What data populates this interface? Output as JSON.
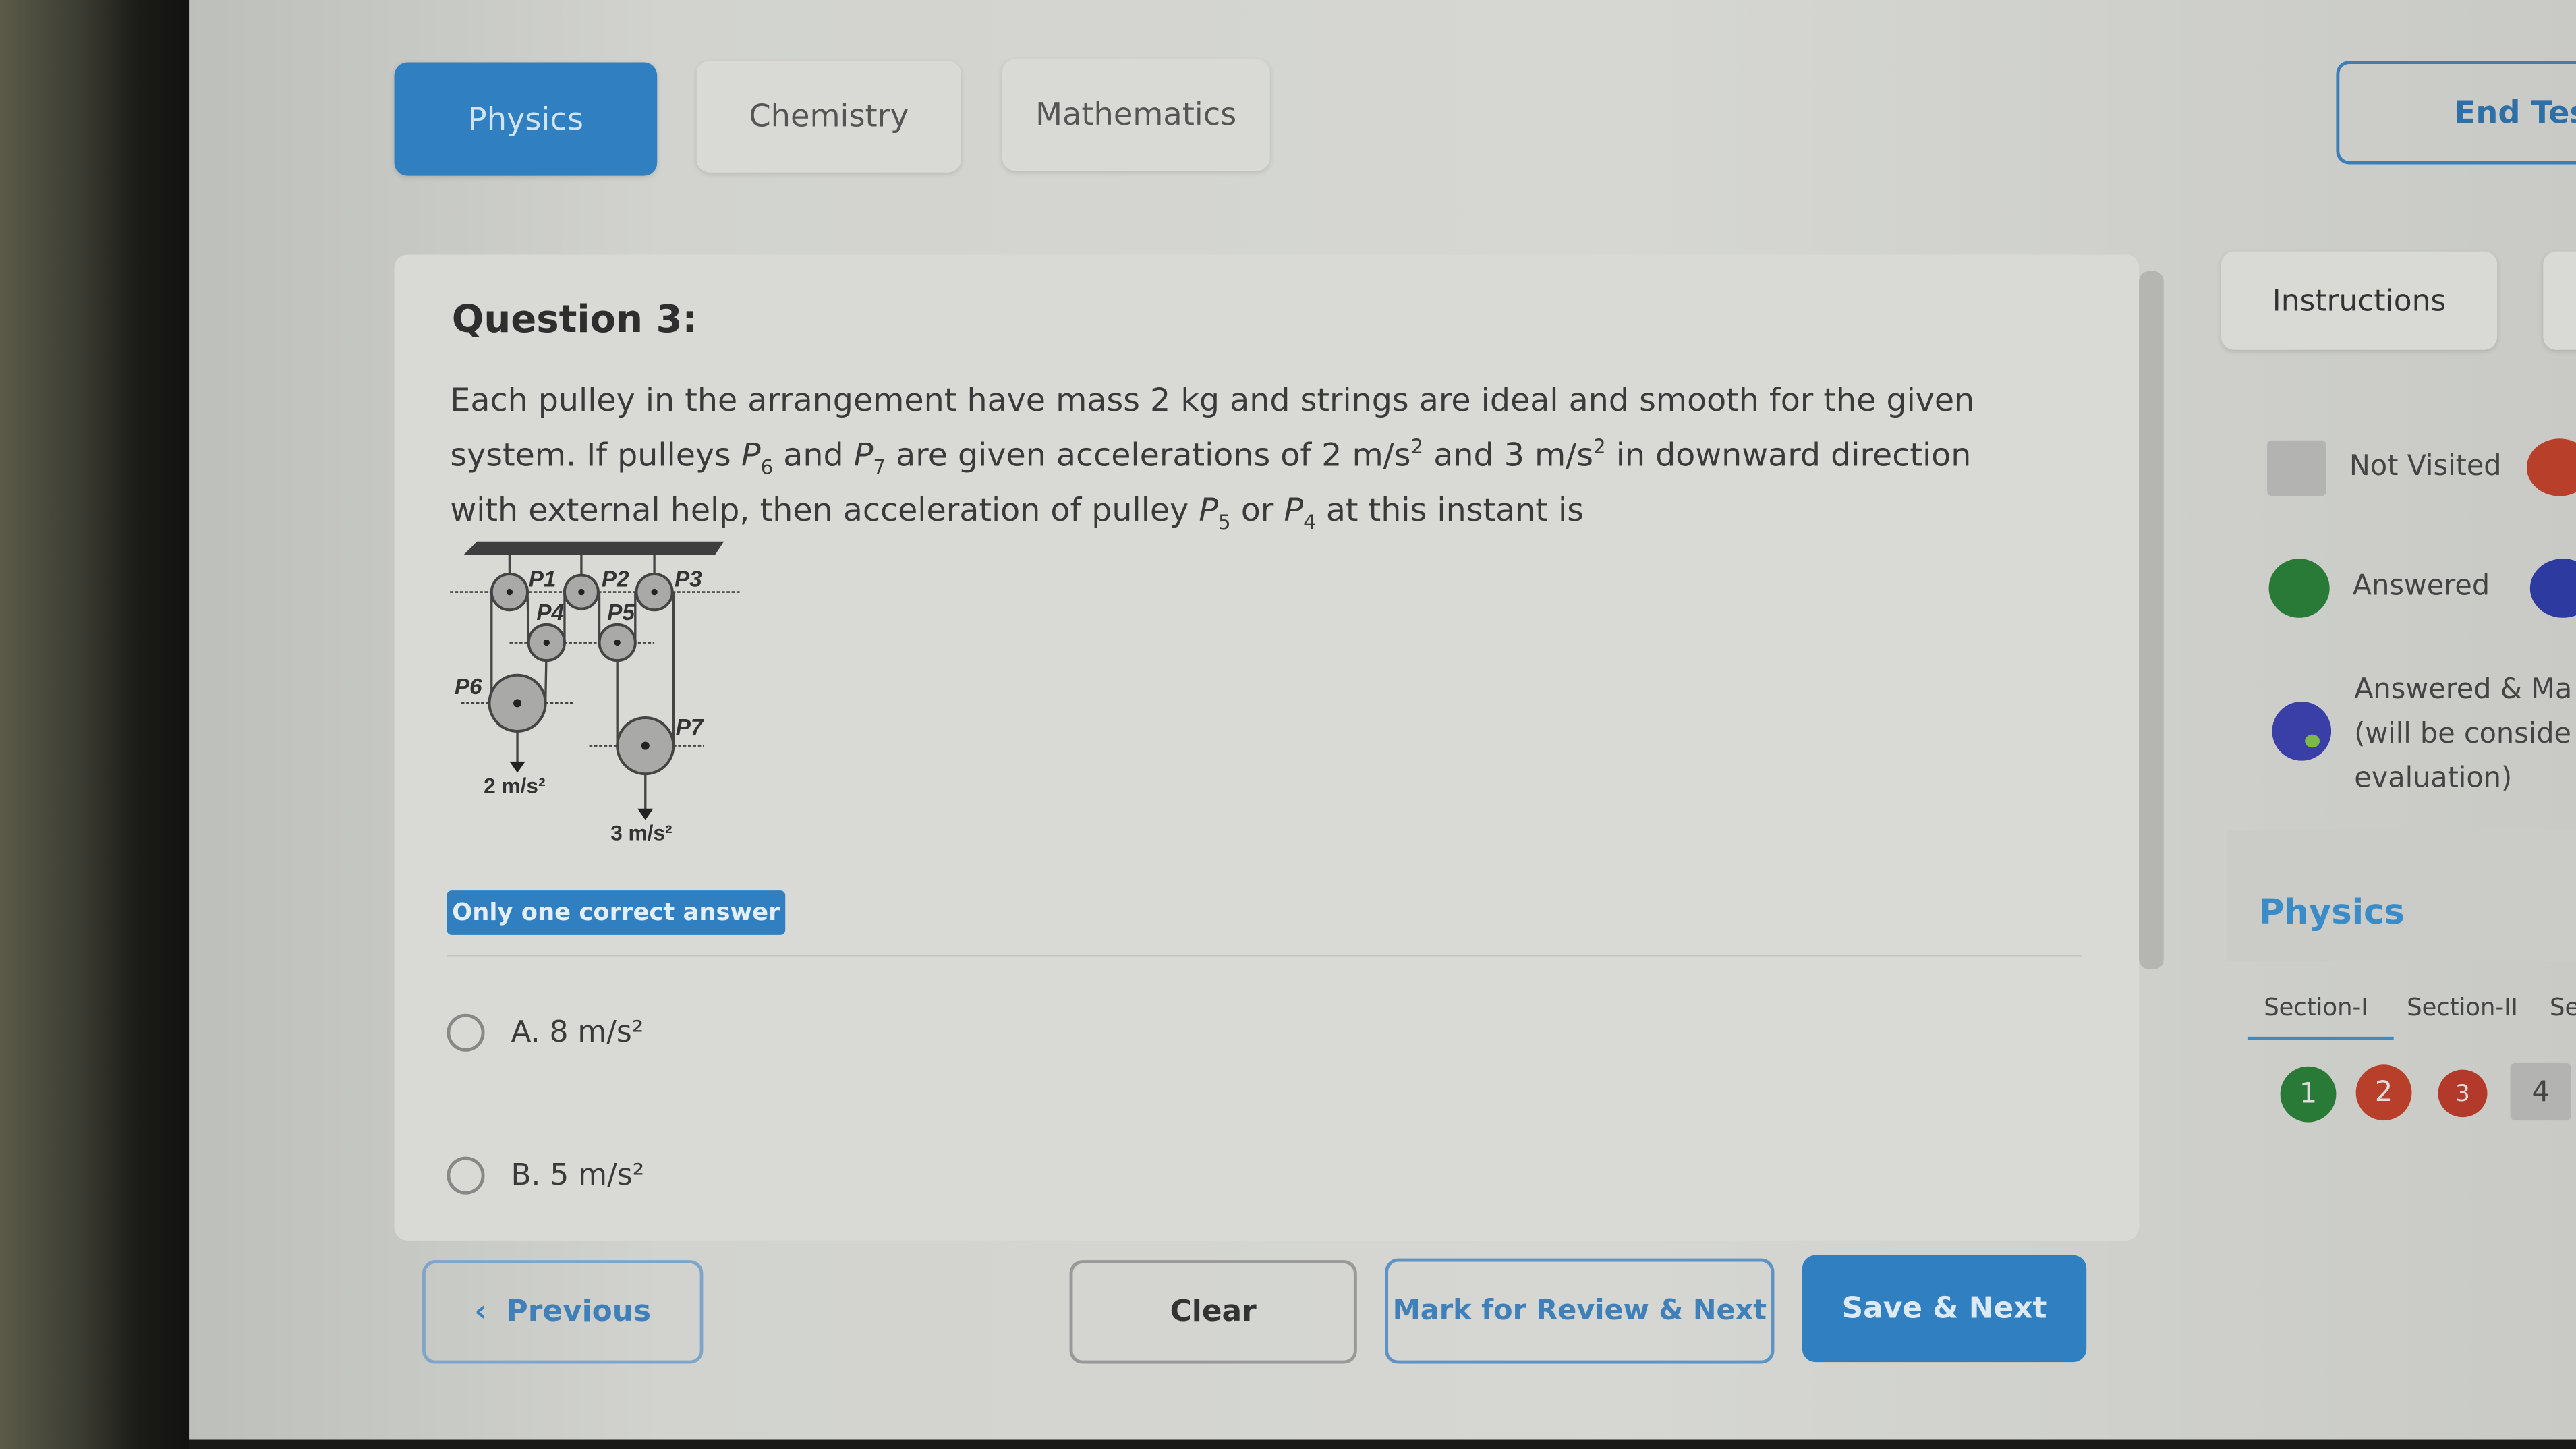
{
  "tabs": [
    {
      "label": "Physics",
      "active": true
    },
    {
      "label": "Chemistry"
    },
    {
      "label": "Mathematics"
    }
  ],
  "end_test_label": "End Tes",
  "question": {
    "title": "Question 3:",
    "lines": [
      "Each pulley in the arrangement have mass 2 kg and strings are ideal and smooth for the given",
      "system. If pulleys P6 and P7 are given accelerations of 2 m/s2 and 3 m/s2 in downward direction",
      "with external help, then acceleration of pulley P5 or P4 at this instant is"
    ],
    "diagram_labels": [
      "P1",
      "P2",
      "P3",
      "P4",
      "P5",
      "P6",
      "P7",
      "2 m/s²",
      "3 m/s²"
    ],
    "badge": "Only one correct answer",
    "options": [
      {
        "label": "A. 8 m/s²",
        "selected": false
      },
      {
        "label": "B. 5 m/s²",
        "selected": false
      }
    ]
  },
  "buttons": {
    "previous": "Previous",
    "clear": "Clear",
    "mark": "Mark for Review & Next",
    "save": "Save & Next"
  },
  "sidebar": {
    "instructions": "Instructions",
    "legend": [
      {
        "label": "Not Visited",
        "color": "#b3b3b1"
      },
      {
        "label": "Answered",
        "color": "#2a7a37"
      },
      {
        "label_lines": [
          "Answered & Ma",
          "(will be conside",
          "evaluation)"
        ],
        "color": "#3a3fa8"
      }
    ],
    "subject": "Physics",
    "sections": [
      "Section-I",
      "Section-II",
      "Se"
    ],
    "questions": [
      {
        "n": "1",
        "status": "answered",
        "color": "#2a7a37"
      },
      {
        "n": "2",
        "status": "not-answered",
        "color": "#c0392b"
      },
      {
        "n": "3",
        "status": "not-answered",
        "color": "#c0392b"
      },
      {
        "n": "4",
        "status": "not-visited",
        "color": "#b3b3b1"
      }
    ]
  },
  "colors": {
    "accent": "#2f7fc1"
  }
}
